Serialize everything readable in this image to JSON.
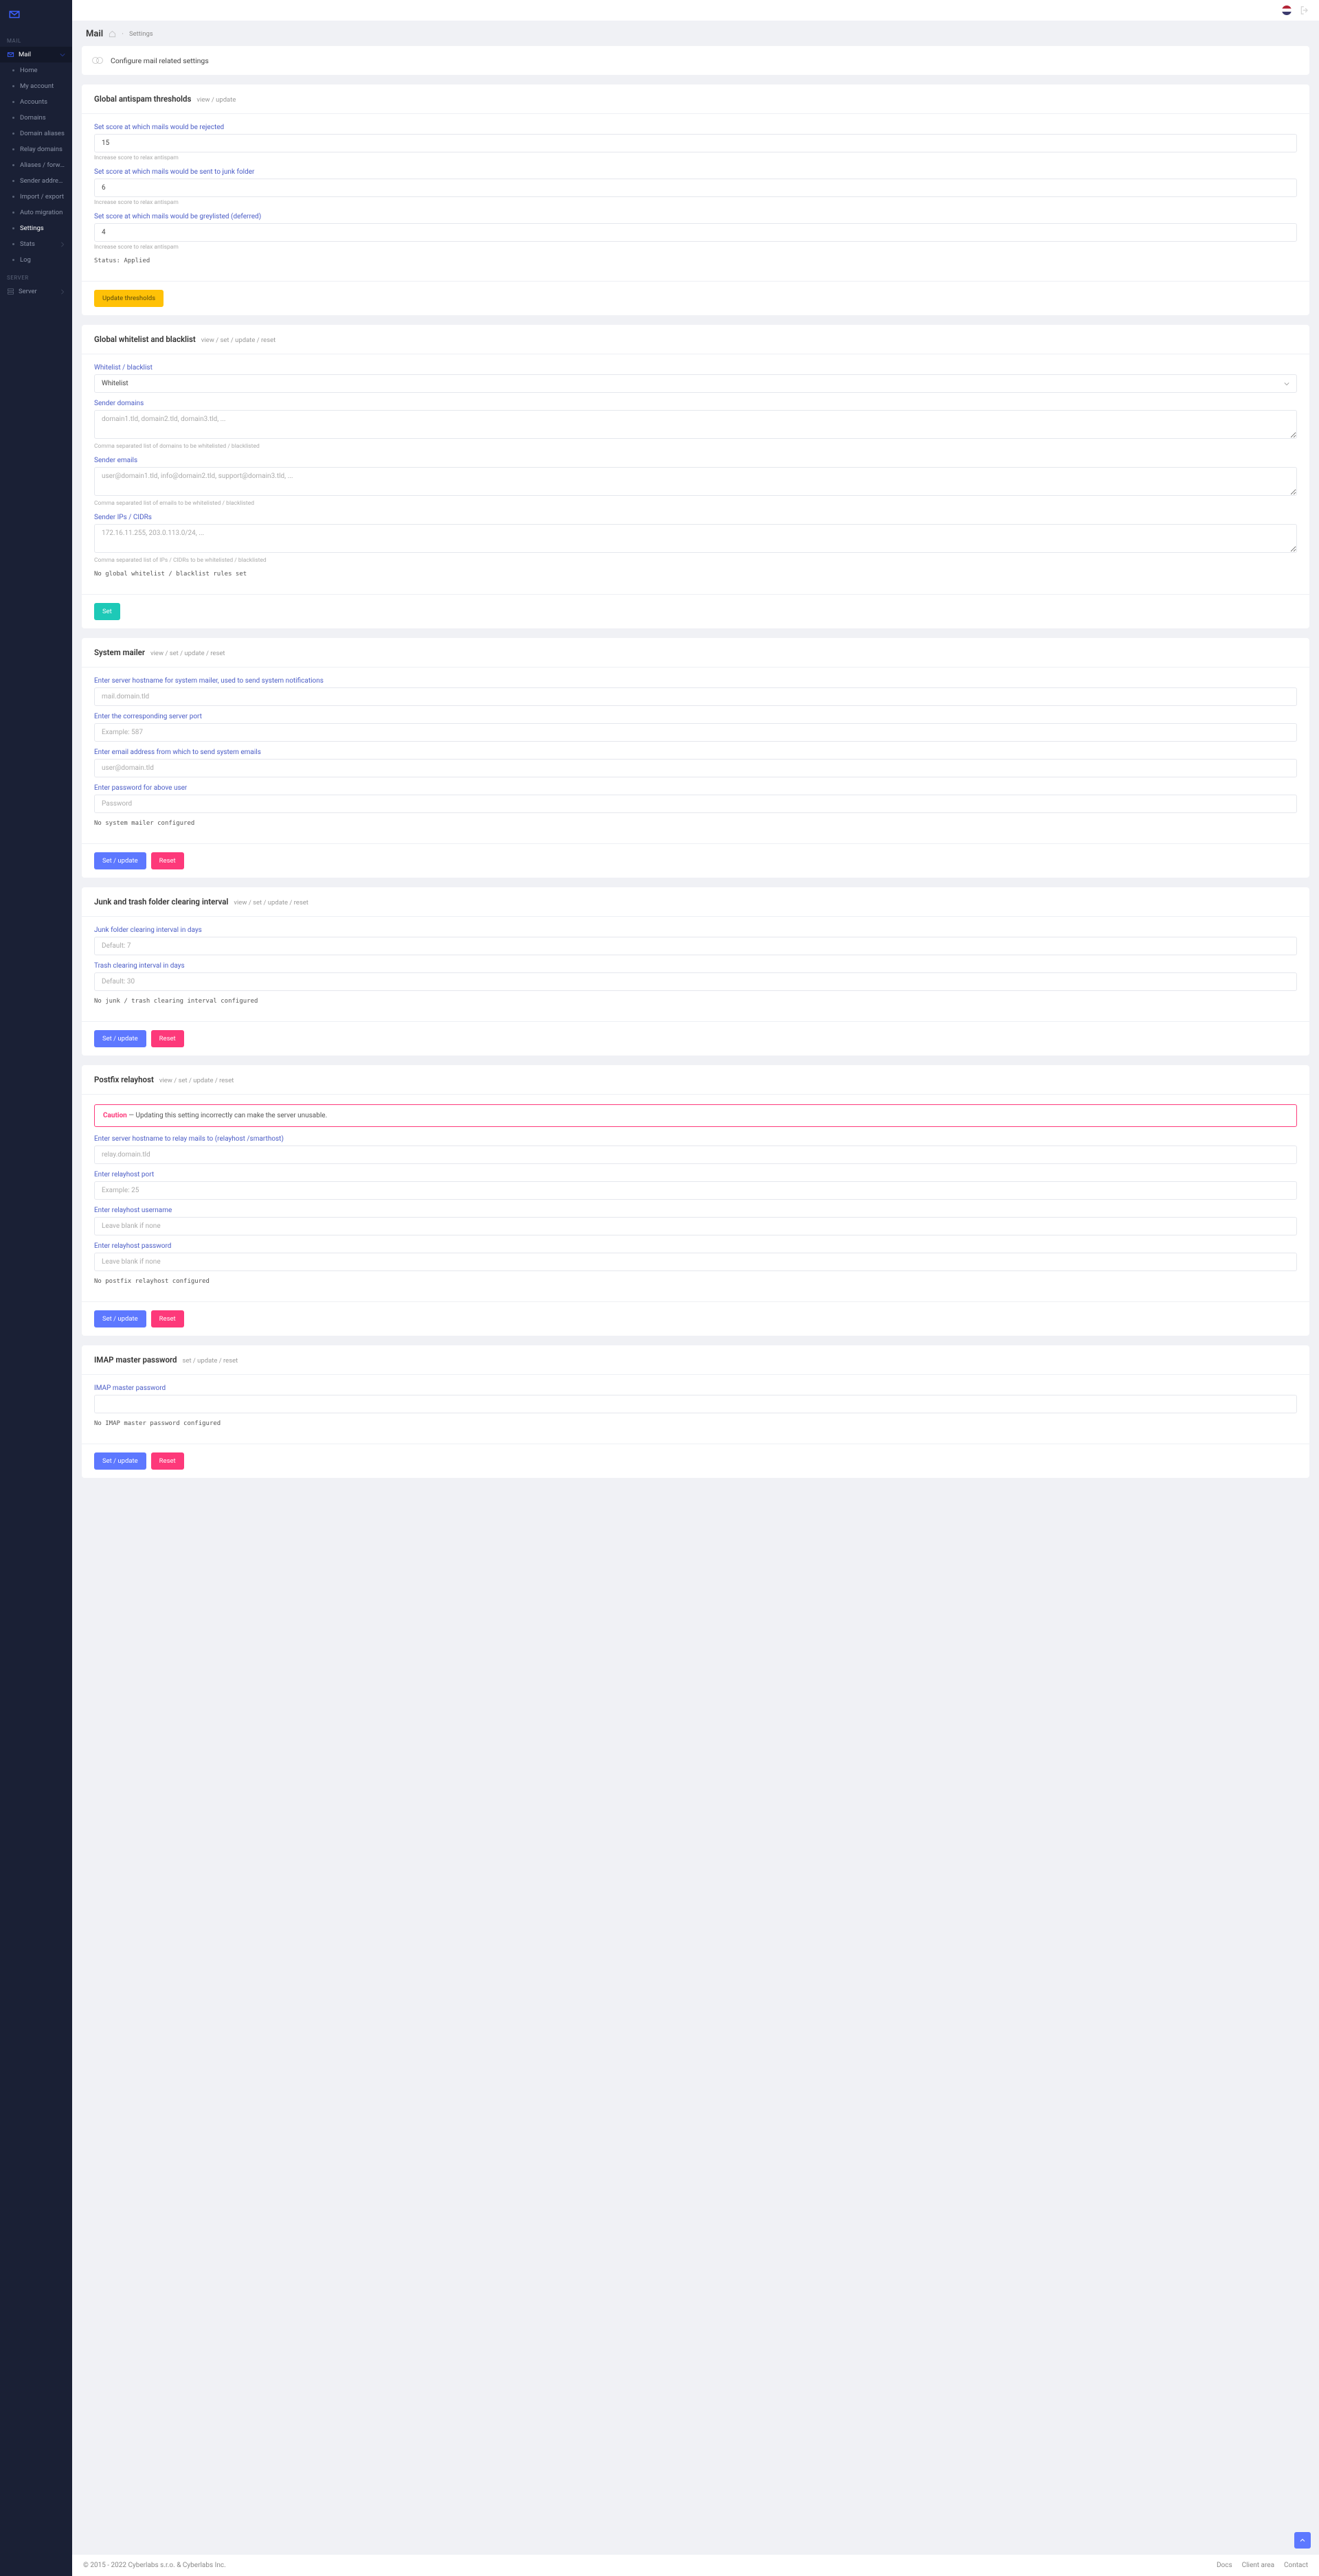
{
  "sidebar": {
    "sections": {
      "mail": "MAIL",
      "server": "SERVER"
    },
    "mail_item": "Mail",
    "server_item": "Server",
    "items": [
      {
        "label": "Home"
      },
      {
        "label": "My account"
      },
      {
        "label": "Accounts"
      },
      {
        "label": "Domains"
      },
      {
        "label": "Domain aliases"
      },
      {
        "label": "Relay domains"
      },
      {
        "label": "Aliases / forwards"
      },
      {
        "label": "Sender addresses"
      },
      {
        "label": "Import / export"
      },
      {
        "label": "Auto migration"
      },
      {
        "label": "Settings"
      },
      {
        "label": "Stats"
      },
      {
        "label": "Log"
      }
    ]
  },
  "breadcrumb": {
    "title": "Mail",
    "crumb": "Settings"
  },
  "info": "Configure mail related settings",
  "antispam": {
    "title": "Global antispam thresholds",
    "subtitle": "view / update",
    "reject_label": "Set score at which mails would be rejected",
    "reject_value": "15",
    "junk_label": "Set score at which mails would be sent to junk folder",
    "junk_value": "6",
    "grey_label": "Set score at which mails would be greylisted (deferred)",
    "grey_value": "4",
    "hint": "Increase score to relax antispam",
    "status": "Status: Applied",
    "button": "Update thresholds"
  },
  "whitelist": {
    "title": "Global whitelist and blacklist",
    "subtitle": "view / set / update / reset",
    "type_label": "Whitelist / blacklist",
    "type_value": "Whitelist",
    "domains_label": "Sender domains",
    "domains_placeholder": "domain1.tld, domain2.tld, domain3.tld, ...",
    "domains_hint": "Comma separated list of domains to be whitelisted / blacklisted",
    "emails_label": "Sender emails",
    "emails_placeholder": "user@domain1.tld, info@domain2.tld, support@domain3.tld, ...",
    "emails_hint": "Comma separated list of emails to be whitelisted / blacklisted",
    "ips_label": "Sender IPs / CIDRs",
    "ips_placeholder": "172.16.11.255, 203.0.113.0/24, ...",
    "ips_hint": "Comma separated list of IPs / CIDRs to be whitelisted / blacklisted",
    "status": "No global whitelist / blacklist rules set",
    "button": "Set"
  },
  "mailer": {
    "title": "System mailer",
    "subtitle": "view / set / update / reset",
    "host_label": "Enter server hostname for system mailer, used to send system notifications",
    "host_placeholder": "mail.domain.tld",
    "port_label": "Enter the corresponding server port",
    "port_placeholder": "Example: 587",
    "email_label": "Enter email address from which to send system emails",
    "email_placeholder": "user@domain.tld",
    "pass_label": "Enter password for above user",
    "pass_placeholder": "Password",
    "status": "No system mailer configured",
    "set_button": "Set / update",
    "reset_button": "Reset"
  },
  "clearing": {
    "title": "Junk and trash folder clearing interval",
    "subtitle": "view / set / update / reset",
    "junk_label": "Junk folder clearing interval in days",
    "junk_placeholder": "Default: 7",
    "trash_label": "Trash clearing interval in days",
    "trash_placeholder": "Default: 30",
    "status": "No junk / trash clearing interval configured",
    "set_button": "Set / update",
    "reset_button": "Reset"
  },
  "relayhost": {
    "title": "Postfix relayhost",
    "subtitle": "view / set / update / reset",
    "caution_label": "Caution",
    "caution_text": " — Updating this setting incorrectly can make the server unusable.",
    "host_label": "Enter server hostname to relay mails to (relayhost /smarthost)",
    "host_placeholder": "relay.domain.tld",
    "port_label": "Enter relayhost port",
    "port_placeholder": "Example: 25",
    "user_label": "Enter relayhost username",
    "user_placeholder": "Leave blank if none",
    "pass_label": "Enter relayhost password",
    "pass_placeholder": "Leave blank if none",
    "status": "No postfix relayhost configured",
    "set_button": "Set / update",
    "reset_button": "Reset"
  },
  "imap": {
    "title": "IMAP master password",
    "subtitle": "set / update / reset",
    "label": "IMAP master password",
    "status": "No IMAP master password configured",
    "set_button": "Set / update",
    "reset_button": "Reset"
  },
  "footer": {
    "copyright": "© 2015 - 2022 Cyberlabs s.r.o. & Cyberlabs Inc.",
    "links": [
      "Docs",
      "Client area",
      "Contact"
    ]
  }
}
